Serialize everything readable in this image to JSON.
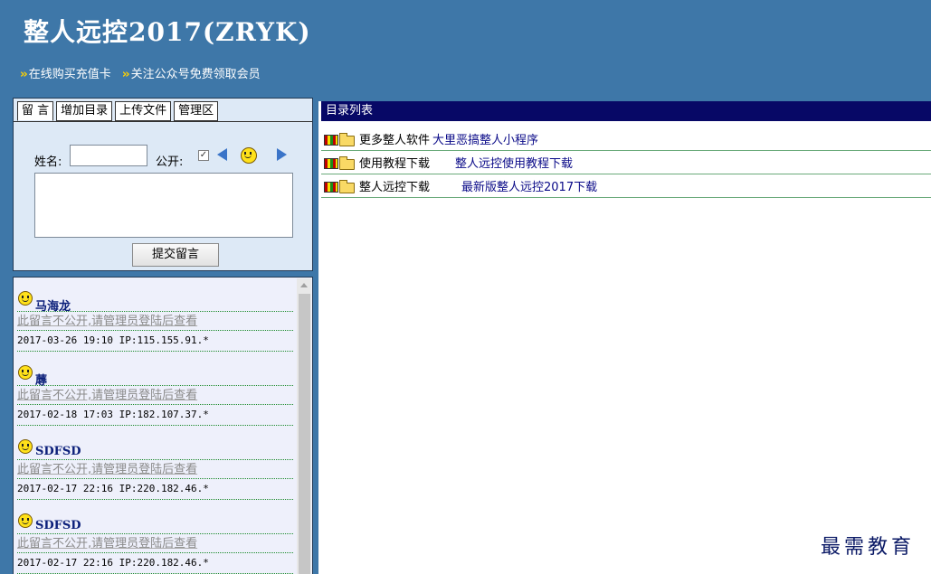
{
  "header": {
    "title": "整人远控2017(ZRYK)",
    "links": [
      {
        "arrow": "››",
        "label": "在线购买充值卡"
      },
      {
        "arrow": "››",
        "label": "关注公众号免费领取会员"
      }
    ]
  },
  "form": {
    "tabs": [
      "留 言",
      "增加目录",
      "上传文件",
      "管理区"
    ],
    "name_label": "姓名:",
    "name_value": "",
    "public_label": "公开:",
    "public_checked": true,
    "message_value": "",
    "submit_label": "提交留言"
  },
  "messages": [
    {
      "name": "马海龙",
      "text": "此留言不公开,请管理员登陆后查看",
      "meta": "2017-03-26 19:10 IP:115.155.91.*"
    },
    {
      "name": "蓐",
      "text": "此留言不公开,请管理员登陆后查看",
      "meta": "2017-02-18 17:03 IP:182.107.37.*"
    },
    {
      "name": "SDFSD",
      "text": "此留言不公开,请管理员登陆后查看",
      "meta": "2017-02-17 22:16 IP:220.182.46.*"
    },
    {
      "name": "SDFSD",
      "text": "此留言不公开,请管理员登陆后查看",
      "meta": "2017-02-17 22:16 IP:220.182.46.*"
    }
  ],
  "directory": {
    "header": "目录列表",
    "rows": [
      {
        "label": "更多整人软件",
        "link": "大里恶搞整人小程序"
      },
      {
        "label": "使用教程下载",
        "link": "整人远控使用教程下载"
      },
      {
        "label": "整人远控下载",
        "link": "最新版整人远控2017下载"
      }
    ]
  },
  "watermark": "最需教育"
}
